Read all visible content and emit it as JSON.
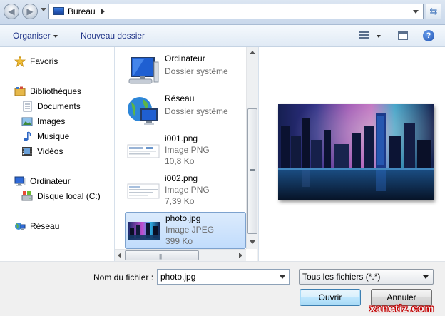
{
  "address_bar": {
    "path": "Bureau",
    "back_glyph": "◀",
    "forward_glyph": "▶",
    "refresh_glyph": "⇆"
  },
  "toolbar": {
    "organize_label": "Organiser",
    "new_folder_label": "Nouveau dossier",
    "help_glyph": "?"
  },
  "nav": {
    "favorites": "Favoris",
    "libraries": "Bibliothèques",
    "library_items": [
      "Documents",
      "Images",
      "Musique",
      "Vidéos"
    ],
    "computer": "Ordinateur",
    "local_disk": "Disque local (C:)",
    "network": "Réseau"
  },
  "files": [
    {
      "name": "Ordinateur",
      "type": "Dossier système",
      "size": "",
      "icon": "computer-icon"
    },
    {
      "name": "Réseau",
      "type": "Dossier système",
      "size": "",
      "icon": "network-globe-icon"
    },
    {
      "name": "i001.png",
      "type": "Image PNG",
      "size": "10,8 Ko",
      "icon": "png-thumbnail"
    },
    {
      "name": "i002.png",
      "type": "Image PNG",
      "size": "7,39 Ko",
      "icon": "png-thumbnail"
    },
    {
      "name": "photo.jpg",
      "type": "Image JPEG",
      "size": "399 Ko",
      "icon": "photo-thumbnail",
      "selected": true
    }
  ],
  "scrollbar_grip": "|||",
  "footer": {
    "filename_label": "Nom du fichier :",
    "filename_value": "photo.jpg",
    "filetype_value": "Tous les fichiers (*.*)",
    "open_label": "Ouvrir",
    "cancel_label": "Annuler"
  },
  "watermark": "xanetiz.com",
  "colors": {
    "accent": "#1e3287",
    "selection": "#c1dcfc",
    "watermark_red": "#c40000"
  }
}
